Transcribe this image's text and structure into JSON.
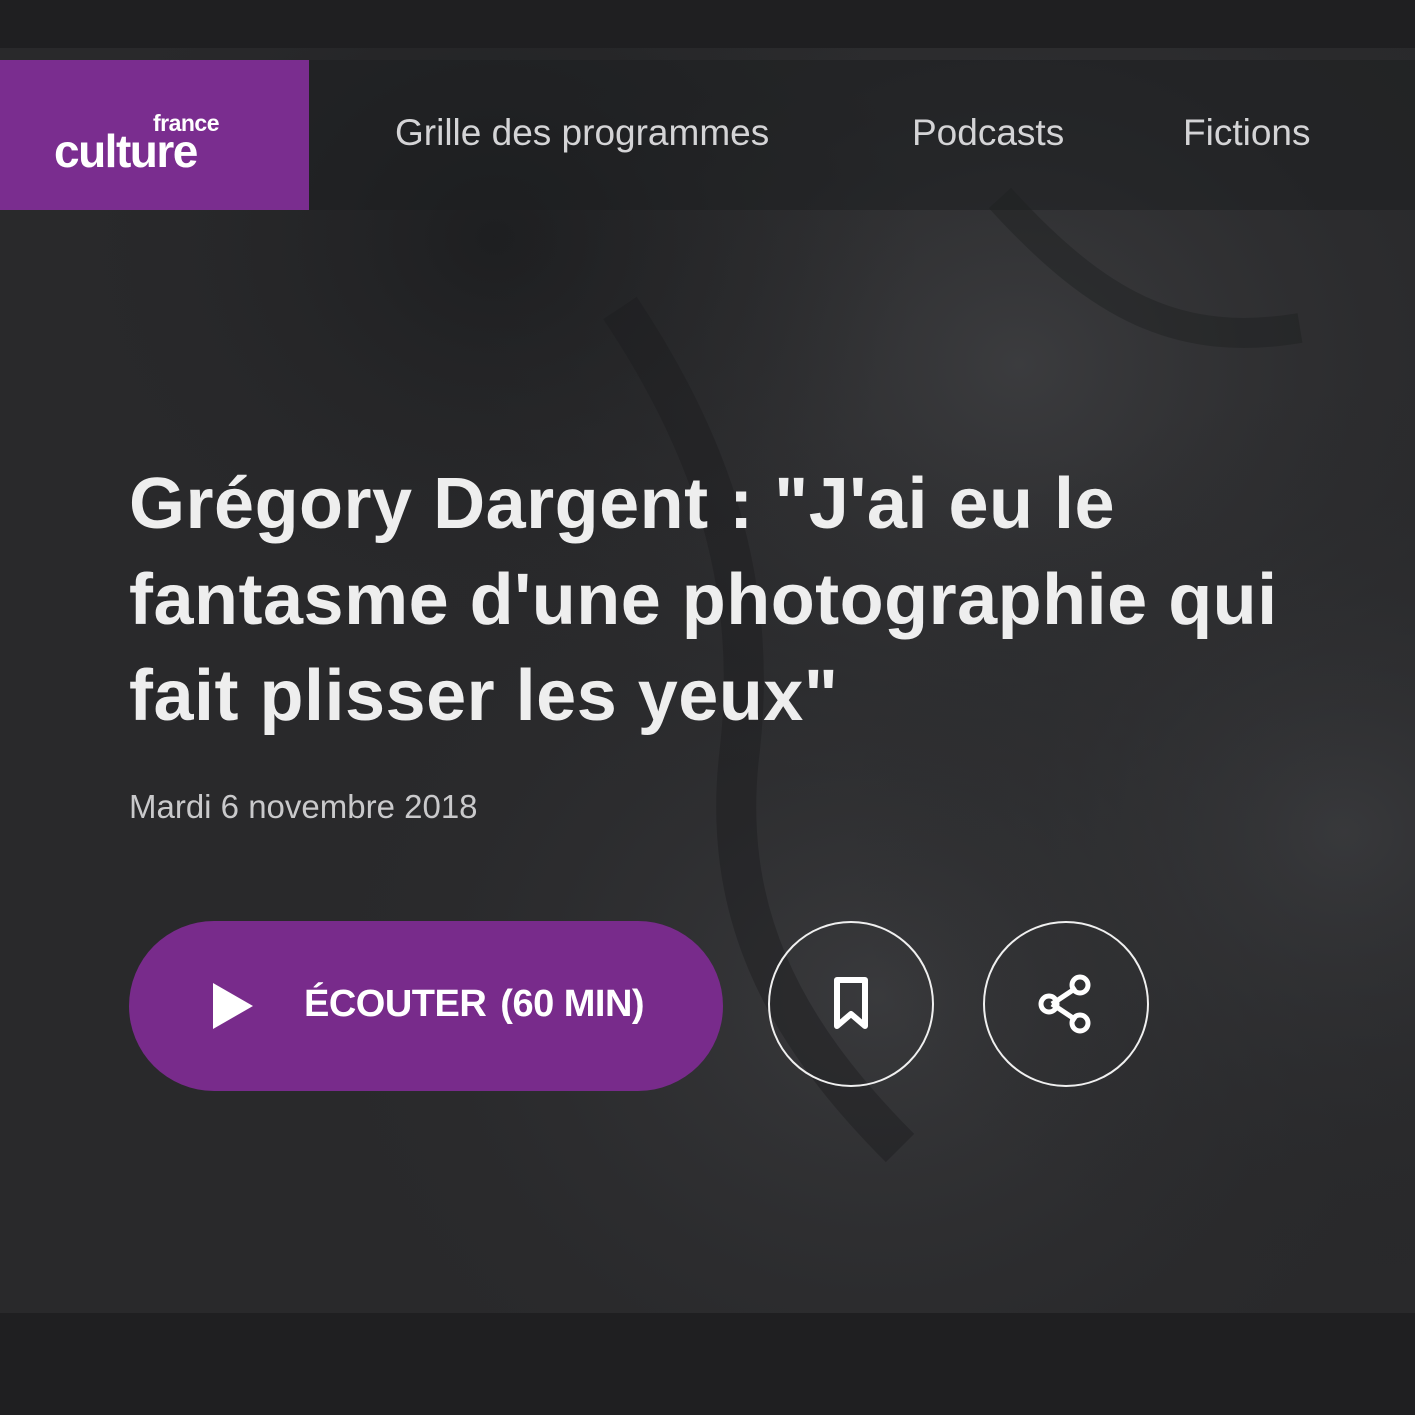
{
  "brand": {
    "logo_small": "france",
    "logo_big": "culture",
    "color": "#7a2d8f"
  },
  "nav": {
    "items": [
      {
        "label": "Grille des programmes"
      },
      {
        "label": "Podcasts"
      },
      {
        "label": "Fictions"
      }
    ]
  },
  "episode": {
    "title": "Grégory Dargent : \"J'ai eu le fantasme d'une photographie qui fait plisser les yeux\"",
    "date": "Mardi 6 novembre 2018"
  },
  "actions": {
    "listen_label": "ÉCOUTER",
    "listen_duration": "(60 MIN)",
    "listen_color": "#782b8b",
    "bookmark_icon": "bookmark-icon",
    "share_icon": "share-icon",
    "play_icon": "play-icon"
  }
}
